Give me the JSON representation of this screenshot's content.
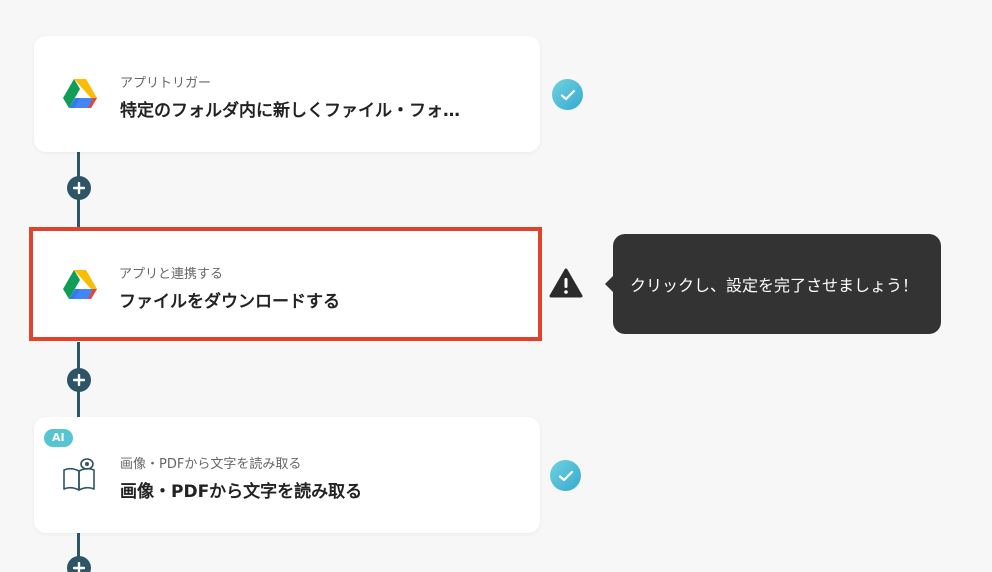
{
  "flow": {
    "steps": [
      {
        "subtitle": "アプリトリガー",
        "title": "特定のフォルダ内に新しくファイル・フォ…",
        "icon": "google-drive-icon",
        "status": "complete"
      },
      {
        "subtitle": "アプリと連携する",
        "title": "ファイルをダウンロードする",
        "icon": "google-drive-icon",
        "status": "incomplete"
      },
      {
        "badge": "AI",
        "subtitle": "画像・PDFから文字を読み取る",
        "title": "画像・PDFから文字を読み取る",
        "icon": "book-eye-icon",
        "status": "complete"
      }
    ]
  },
  "tooltip": {
    "text": "クリックし、設定を完了させましょう！"
  },
  "colors": {
    "connector": "#2d5566",
    "selected_border": "#e0422b",
    "check_badge": "#46b8d6",
    "ai_badge": "#57c4d2",
    "tooltip_bg": "#333333"
  }
}
